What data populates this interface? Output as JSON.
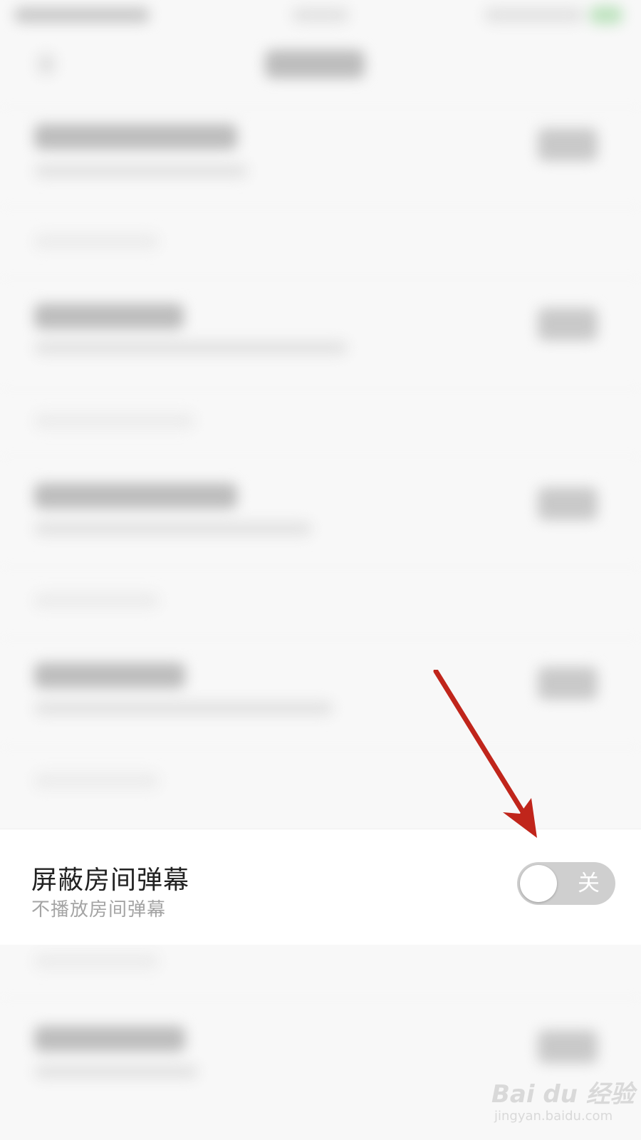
{
  "setting": {
    "title": "屏蔽房间弹幕",
    "subtitle": "不播放房间弹幕",
    "toggle": {
      "state": "off",
      "label": "关",
      "track_color": "#cfcfcf"
    }
  },
  "annotation": {
    "type": "arrow",
    "color": "#c0251b",
    "points_to": "toggle"
  },
  "watermark": {
    "brand": "Bai du 经验",
    "url": "jingyan.baidu.com"
  },
  "colors": {
    "title_text": "#222222",
    "subtitle_text": "#a4a4a4",
    "background": "#f8f8f8",
    "card": "#ffffff"
  }
}
